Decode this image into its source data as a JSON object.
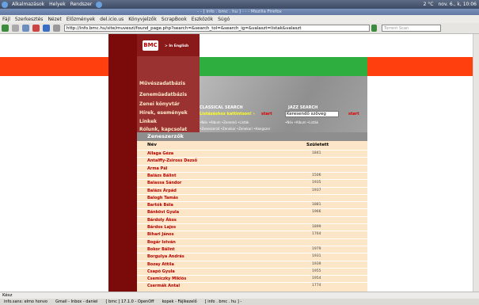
{
  "gnome": {
    "apps": "Alkalmazások",
    "places": "Helyek",
    "system": "Rendszer",
    "weather": "2 °C",
    "date": "nov. 6., k, 10:06"
  },
  "window": {
    "title": "- - [ info . bmc . hu ] - - - Mozilla Firefox"
  },
  "menus": [
    "Fájl",
    "Szerkesztés",
    "Nézet",
    "Előzmények",
    "del.icio.us",
    "Könyvjelzők",
    "ScrapBook",
    "Eszközök",
    "Súgó"
  ],
  "nav": {
    "url": "http://info.bmc.hu/site/muveszi/found_page.php?search=&search_tol=&search_ig=&valaszt=listak&valaszt",
    "search_placeholder": "Torrent Scan"
  },
  "site": {
    "logo": "BMC",
    "english": "> In English",
    "menu": [
      "Művészadatbázis",
      "Zeneműadatbázis",
      "Zenei könyvtár",
      "Hírek, események",
      "Linkek",
      "Rólunk, kapcsolat"
    ],
    "classical_title": "CLASSICAL SEARCH",
    "classical_sub": "Listázáshoz kattintson! ›",
    "classical_go": "start",
    "classical_opts": "•Név •Album •Zenemű •Listák",
    "classical_opts2": "•Zeneszerző •Zenekar •Zenekari •Hangszer",
    "jazz_title": "JAZZ SEARCH",
    "jazz_input": "Keresendő szöveg",
    "jazz_go": "start",
    "jazz_opts": "•Név •Album •Listák"
  },
  "composers": {
    "title": "Zeneszerzők",
    "col_name": "Név",
    "col_born": "Született",
    "rows": [
      {
        "name": "Allaga Géza",
        "year": "1841"
      },
      {
        "name": "Antalffy-Zsiross Dezső",
        "year": ""
      },
      {
        "name": "Arma Pál",
        "year": ""
      },
      {
        "name": "Balázs Bálint",
        "year": "1506"
      },
      {
        "name": "Balassa Sándor",
        "year": "1935"
      },
      {
        "name": "Balázs Árpád",
        "year": "1937"
      },
      {
        "name": "Balogh Tamás",
        "year": ""
      },
      {
        "name": "Bartók Béla",
        "year": "1881"
      },
      {
        "name": "Bánkövi Gyula",
        "year": "1966"
      },
      {
        "name": "Bárdoly Ákos",
        "year": ""
      },
      {
        "name": "Bárdos Lajos",
        "year": "1899"
      },
      {
        "name": "Bihari János",
        "year": "1764"
      },
      {
        "name": "Bogár István",
        "year": ""
      },
      {
        "name": "Bokor Bálint",
        "year": "1979"
      },
      {
        "name": "Borgulya András",
        "year": "1931"
      },
      {
        "name": "Bozay Attila",
        "year": "1939"
      },
      {
        "name": "Csapó Gyula",
        "year": "1955"
      },
      {
        "name": "Csemiczky Miklós",
        "year": "1954"
      },
      {
        "name": "Csermák Antal",
        "year": "1774"
      }
    ]
  },
  "status": "Kész",
  "taskbar": [
    "info.sans: elmo honvo",
    "Gmail - Inbox - daniel",
    "[ bmc ] 17.1.0 - OpenOff",
    "kopek - Fájlkezelő",
    "[ info . bmc . hu ] -"
  ],
  "colors": {
    "red": "#ff3f0d",
    "green": "#2eae3f",
    "maroon": "#7b0b0b",
    "table": "#fde6c7"
  }
}
